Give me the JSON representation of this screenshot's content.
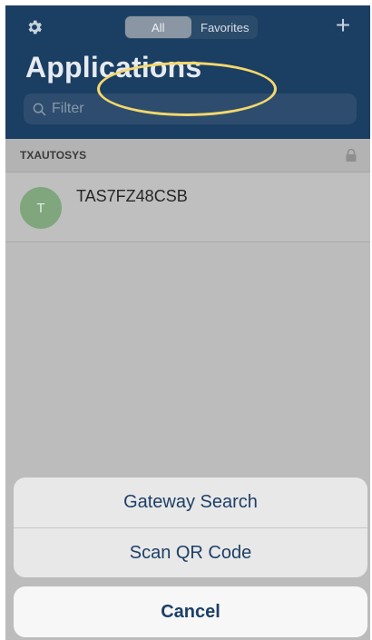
{
  "header": {
    "settings_icon": "gear-icon",
    "segments": [
      {
        "label": "All",
        "selected": true
      },
      {
        "label": "Favorites",
        "selected": false
      }
    ],
    "add_label": "+",
    "title": "Applications",
    "filter": {
      "placeholder": "Filter",
      "value": "",
      "icon": "search-icon"
    }
  },
  "section": {
    "title": "TXAUTOSYS",
    "icon": "lock-icon"
  },
  "apps": [
    {
      "initial": "T",
      "name": "TAS7FZ48CSB"
    }
  ],
  "action_sheet": {
    "options": [
      "Gateway Search",
      "Scan QR Code"
    ],
    "cancel_label": "Cancel",
    "highlight_color": "#f5d86b"
  },
  "colors": {
    "header_bg": "#1b3e63",
    "action_text": "#1d3f66",
    "avatar_bg": "#7fa67d"
  }
}
